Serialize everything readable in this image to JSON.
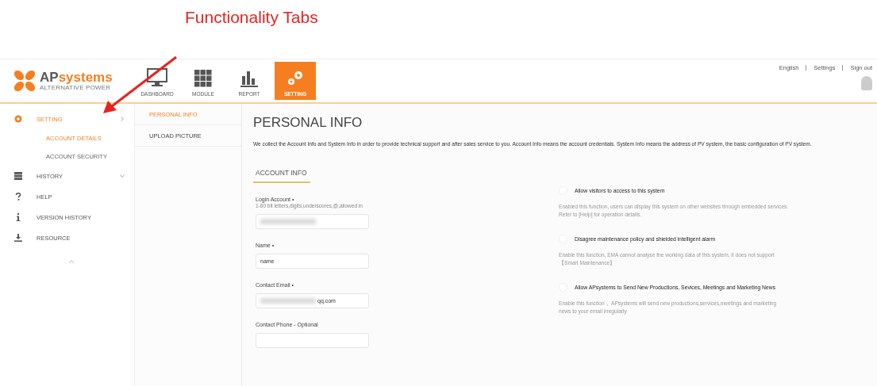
{
  "annotation": {
    "label": "Functionality Tabs"
  },
  "logo": {
    "brand_a": "AP",
    "brand_b": "systems",
    "tagline": "ALTERNATIVE POWER"
  },
  "nav": [
    {
      "label": "DASHBOARD",
      "kind": "monitor",
      "selected": false
    },
    {
      "label": "MODULE",
      "kind": "grid",
      "selected": false
    },
    {
      "label": "REPORT",
      "kind": "chart",
      "selected": false
    },
    {
      "label": "SETTING",
      "kind": "gears",
      "selected": true
    }
  ],
  "top_links": [
    "English",
    "Settings",
    "Sign out"
  ],
  "sidebar": {
    "items": [
      {
        "label": "SETTING",
        "kind": "gear",
        "selected": true,
        "expanded": true,
        "children": [
          {
            "label": "ACCOUNT DETAILS",
            "selected": true
          },
          {
            "label": "ACCOUNT SECURITY",
            "selected": false
          }
        ]
      },
      {
        "label": "HISTORY",
        "kind": "database",
        "selected": false,
        "expanded": false
      },
      {
        "label": "HELP",
        "kind": "question",
        "selected": false
      },
      {
        "label": "VERSION HISTORY",
        "kind": "info",
        "selected": false
      },
      {
        "label": "RESOURCE",
        "kind": "download",
        "selected": false
      }
    ]
  },
  "subnav": [
    {
      "label": "PERSONAL INFO",
      "selected": true
    },
    {
      "label": "UPLOAD PICTURE",
      "selected": false
    }
  ],
  "page": {
    "title": "PERSONAL INFO",
    "description": "We collect the Account Info and System Info in order to provide technical support and after sales service to you. Account Info means the account credentials. System Info means the address of PV system, the basic configuration of PV system.",
    "section": "ACCOUNT INFO"
  },
  "fields": [
    {
      "label": "Login Account",
      "marker": "•",
      "hint": "1-60 bit letters,digits,underscores,@,allowed in",
      "kind": "blurred"
    },
    {
      "label": "Name",
      "marker": "•",
      "value": "name",
      "kind": "text"
    },
    {
      "label": "Contact Email",
      "marker": "•",
      "value": "qq.com",
      "kind": "blurred_prefix"
    },
    {
      "label": "Contact Phone",
      "marker": "- Optional",
      "kind": "empty"
    }
  ],
  "options": [
    {
      "label": "Allow visitors to access to this system",
      "checked": false,
      "description": "Enabled this function, users can display this system on other websites through embedded services. Refer to [Help] for operation details."
    },
    {
      "label": "Disagree maintenance policy and shielded intelligent alarm",
      "checked": false,
      "description": "Enable this function, EMA cannot analyse the working data of this system, it does not support 【Smart Maintenance】"
    },
    {
      "label": "Allow APsystems to Send New Productions, Sevices, Meetings and Marketing News",
      "checked": false,
      "description": "Enable this function， APsystems will send new productions,services,meetings and marketing news to your email irregularly"
    }
  ]
}
